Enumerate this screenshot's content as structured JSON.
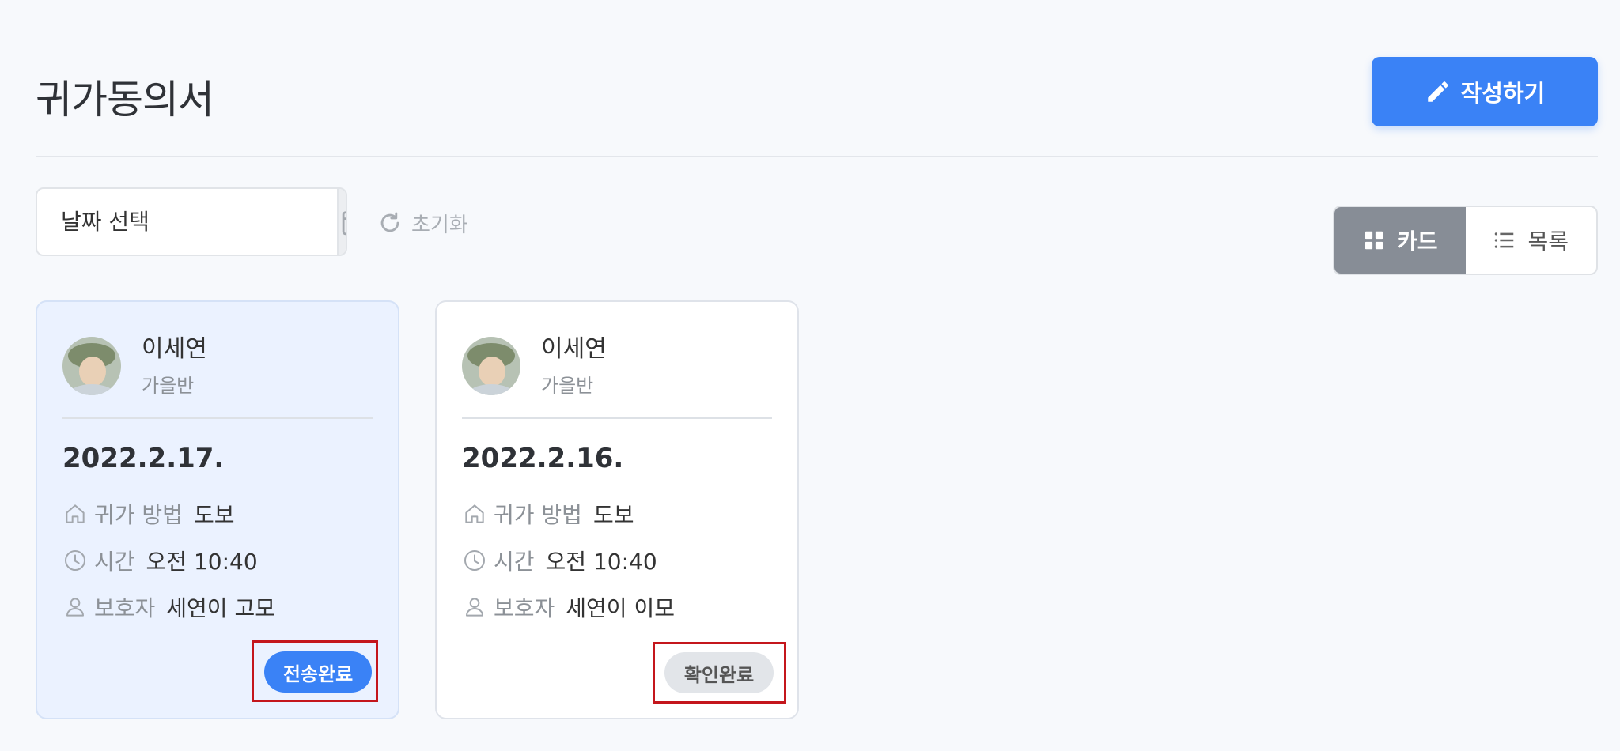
{
  "header": {
    "title": "귀가동의서",
    "write_label": "작성하기"
  },
  "filters": {
    "date_placeholder": "날짜 선택",
    "reset_label": "초기화"
  },
  "view_toggle": {
    "card_label": "카드",
    "list_label": "목록",
    "active": "카드"
  },
  "cards": [
    {
      "name": "이세연",
      "class": "가을반",
      "date": "2022.2.17.",
      "method_label": "귀가 방법",
      "method_value": "도보",
      "time_label": "시간",
      "time_value": "오전 10:40",
      "guardian_label": "보호자",
      "guardian_value": "세연이 고모",
      "status": "전송완료"
    },
    {
      "name": "이세연",
      "class": "가을반",
      "date": "2022.2.16.",
      "method_label": "귀가 방법",
      "method_value": "도보",
      "time_label": "시간",
      "time_value": "오전 10:40",
      "guardian_label": "보호자",
      "guardian_value": "세연이 이모",
      "status": "확인완료"
    }
  ],
  "colors": {
    "primary": "#3a82f6",
    "highlight": "#c4161c",
    "selected_card_bg": "#ebf2ff"
  }
}
